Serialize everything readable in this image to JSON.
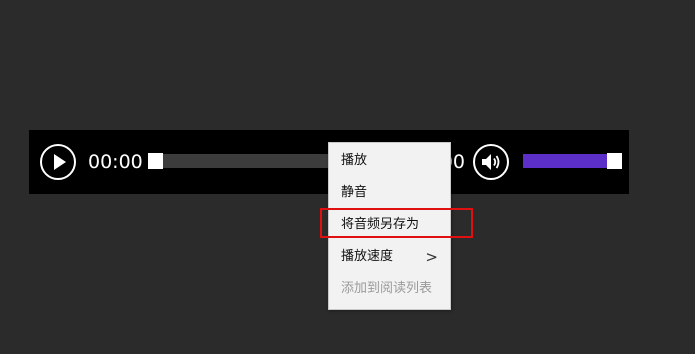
{
  "player": {
    "current_time": "00:00",
    "total_time": "00:00",
    "seek_progress": 0,
    "volume_level": 0.88,
    "accent_color": "#5b2fc8",
    "play_icon": "play-icon",
    "volume_icon": "speaker-volume-icon"
  },
  "menu": {
    "items": [
      {
        "label": "播放",
        "enabled": true
      },
      {
        "label": "静音",
        "enabled": true
      },
      {
        "label": "将音频另存为",
        "enabled": true,
        "highlighted": true
      },
      {
        "label": "播放速度",
        "enabled": true,
        "submenu": true
      },
      {
        "label": "添加到阅读列表",
        "enabled": false
      }
    ],
    "submenu_glyph": ">",
    "highlight_color": "#e01010"
  }
}
